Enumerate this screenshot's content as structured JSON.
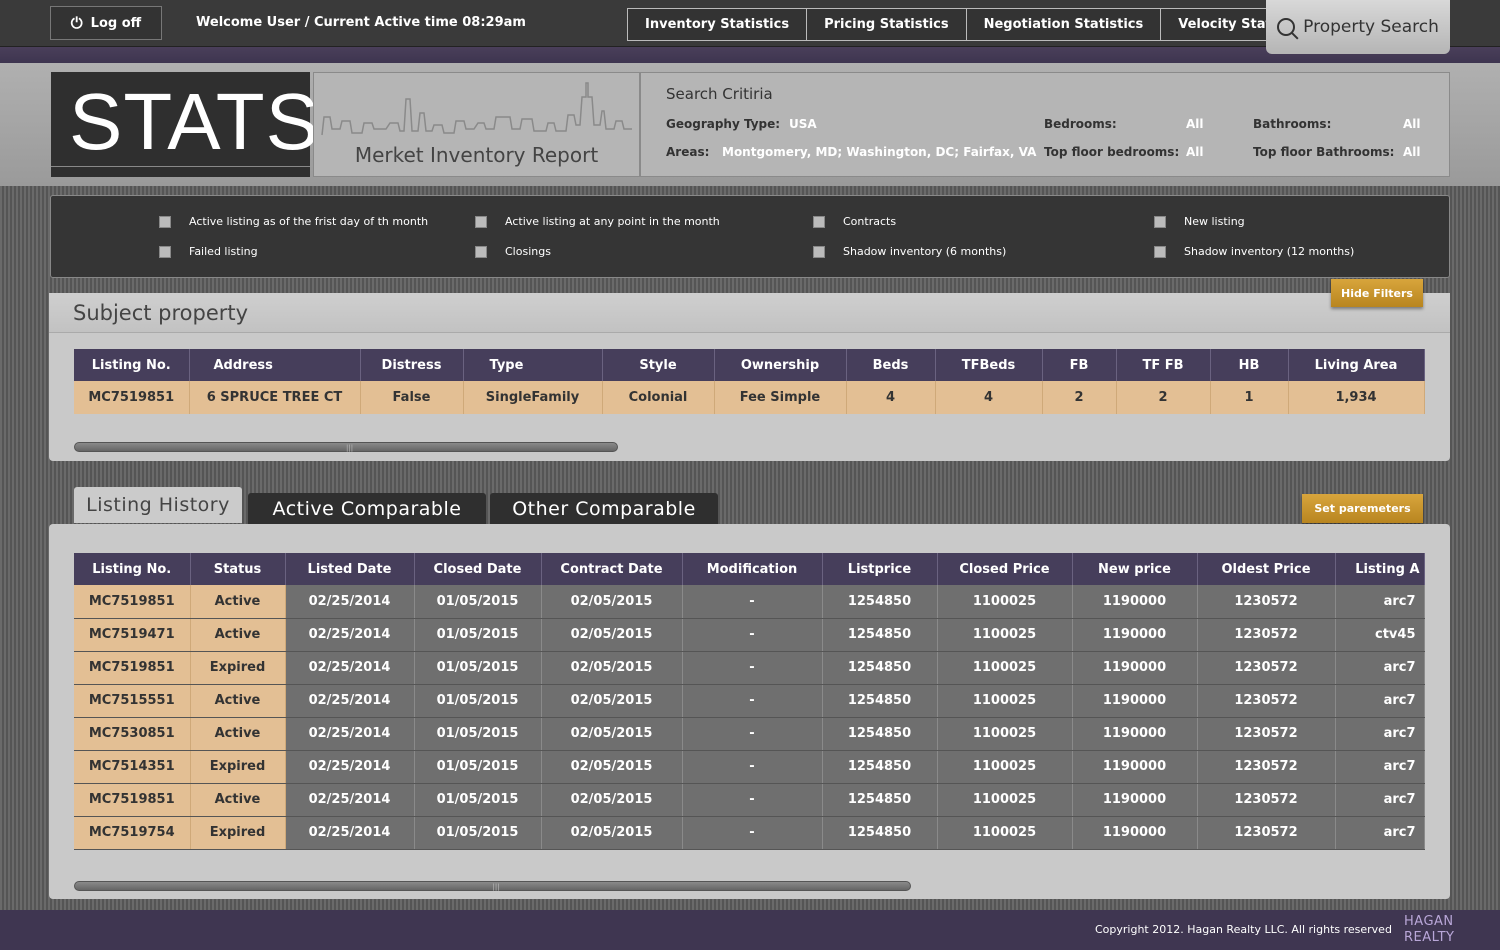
{
  "topbar": {
    "logoff_label": "Log off",
    "welcome_text": "Welcome User / Current Active time 08:29am",
    "nav_tabs": [
      "Inventory Statistics",
      "Pricing Statistics",
      "Negotiation Statistics",
      "Velocity Statistics"
    ],
    "property_search_label": "Property Search"
  },
  "header": {
    "logo_text": "STATS",
    "report_title": "Merket Inventory Report",
    "criteria_title": "Search Critiria",
    "geography_label": "Geography Type:",
    "geography_value": "USA",
    "areas_label": "Areas:",
    "areas_value": "Montgomery, MD; Washington, DC; Fairfax, VA",
    "bedrooms_label": "Bedrooms:",
    "bedrooms_value": "All",
    "top_floor_bedrooms_label": "Top floor bedrooms:",
    "top_floor_bedrooms_value": "All",
    "bathrooms_label": "Bathrooms:",
    "bathrooms_value": "All",
    "top_floor_bathrooms_label": "Top floor Bathrooms:",
    "top_floor_bathrooms_value": "All"
  },
  "filters": [
    "Active listing as of the frist day of th month",
    "Active listing at any point in the month",
    "Contracts",
    "New listing",
    "Failed listing",
    "Closings",
    "Shadow inventory (6 months)",
    "Shadow inventory (12 months)"
  ],
  "hide_filters_label": "Hide Filters",
  "subject": {
    "title": "Subject property",
    "columns": [
      "Listing No.",
      "Address",
      "Distress",
      "Type",
      "Style",
      "Ownership",
      "Beds",
      "TFBeds",
      "FB",
      "TF FB",
      "HB",
      "Living Area"
    ],
    "row": [
      "MC7519851",
      "6 SPRUCE TREE CT",
      "False",
      "SingleFamily",
      "Colonial",
      "Fee Simple",
      "4",
      "4",
      "2",
      "2",
      "1",
      "1,934"
    ]
  },
  "tabs": [
    "Listing History",
    "Active Comparable",
    "Other Comparable"
  ],
  "set_params_label": "Set paremeters",
  "history": {
    "columns": [
      "Listing No.",
      "Status",
      "Listed Date",
      "Closed Date",
      "Contract Date",
      "Modification",
      "Listprice",
      "Closed Price",
      "New price",
      "Oldest Price",
      "Listing A"
    ],
    "rows": [
      [
        "MC7519851",
        "Active",
        "02/25/2014",
        "01/05/2015",
        "02/05/2015",
        "-",
        "1254850",
        "1100025",
        "1190000",
        "1230572",
        "arc7"
      ],
      [
        "MC7519471",
        "Active",
        "02/25/2014",
        "01/05/2015",
        "02/05/2015",
        "-",
        "1254850",
        "1100025",
        "1190000",
        "1230572",
        "ctv45"
      ],
      [
        "MC7519851",
        "Expired",
        "02/25/2014",
        "01/05/2015",
        "02/05/2015",
        "-",
        "1254850",
        "1100025",
        "1190000",
        "1230572",
        "arc7"
      ],
      [
        "MC7515551",
        "Active",
        "02/25/2014",
        "01/05/2015",
        "02/05/2015",
        "-",
        "1254850",
        "1100025",
        "1190000",
        "1230572",
        "arc7"
      ],
      [
        "MC7530851",
        "Active",
        "02/25/2014",
        "01/05/2015",
        "02/05/2015",
        "-",
        "1254850",
        "1100025",
        "1190000",
        "1230572",
        "arc7"
      ],
      [
        "MC7514351",
        "Expired",
        "02/25/2014",
        "01/05/2015",
        "02/05/2015",
        "-",
        "1254850",
        "1100025",
        "1190000",
        "1230572",
        "arc7"
      ],
      [
        "MC7519851",
        "Active",
        "02/25/2014",
        "01/05/2015",
        "02/05/2015",
        "-",
        "1254850",
        "1100025",
        "1190000",
        "1230572",
        "arc7"
      ],
      [
        "MC7519754",
        "Expired",
        "02/25/2014",
        "01/05/2015",
        "02/05/2015",
        "-",
        "1254850",
        "1100025",
        "1190000",
        "1230572",
        "arc7"
      ]
    ]
  },
  "footer": {
    "copyright": "Copyright 2012. Hagan Realty LLC. All rights reserved",
    "brand_line1": "HAGAN",
    "brand_line2": "REALTY"
  },
  "colors": {
    "header_purple": "#463e5b",
    "highlight_tan": "#e3bf94",
    "button_gold": "#c8952c",
    "footer_purple": "#3f3651"
  }
}
